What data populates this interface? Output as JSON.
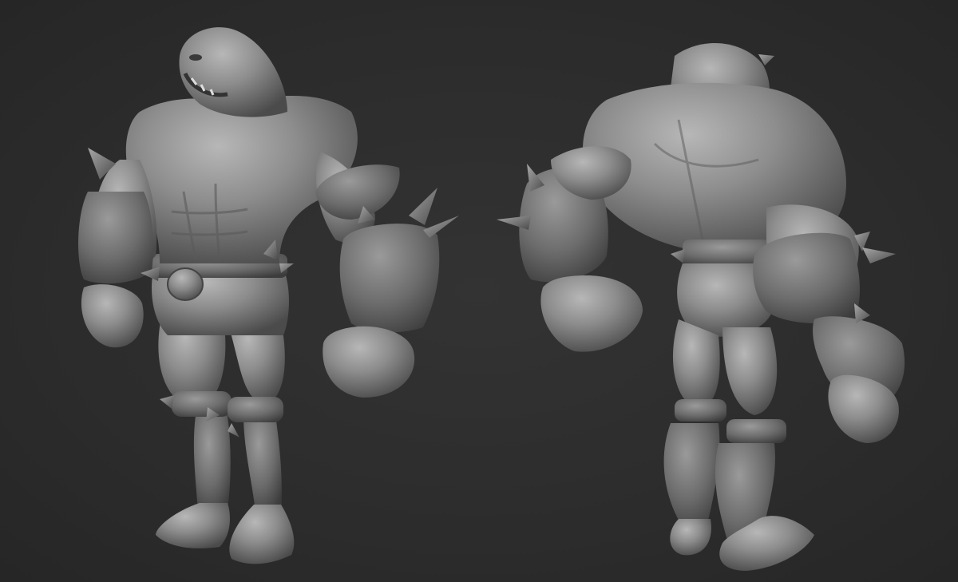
{
  "scene": {
    "background_color": "#2d2d2d",
    "clay_color": "#8a8a8a",
    "clay_light": "#b4b4b4",
    "clay_dark": "#4a4a4a",
    "views": [
      {
        "id": "front",
        "description_icon": "muscular-creature-front-view"
      },
      {
        "id": "back",
        "description_icon": "muscular-creature-back-view"
      }
    ]
  }
}
